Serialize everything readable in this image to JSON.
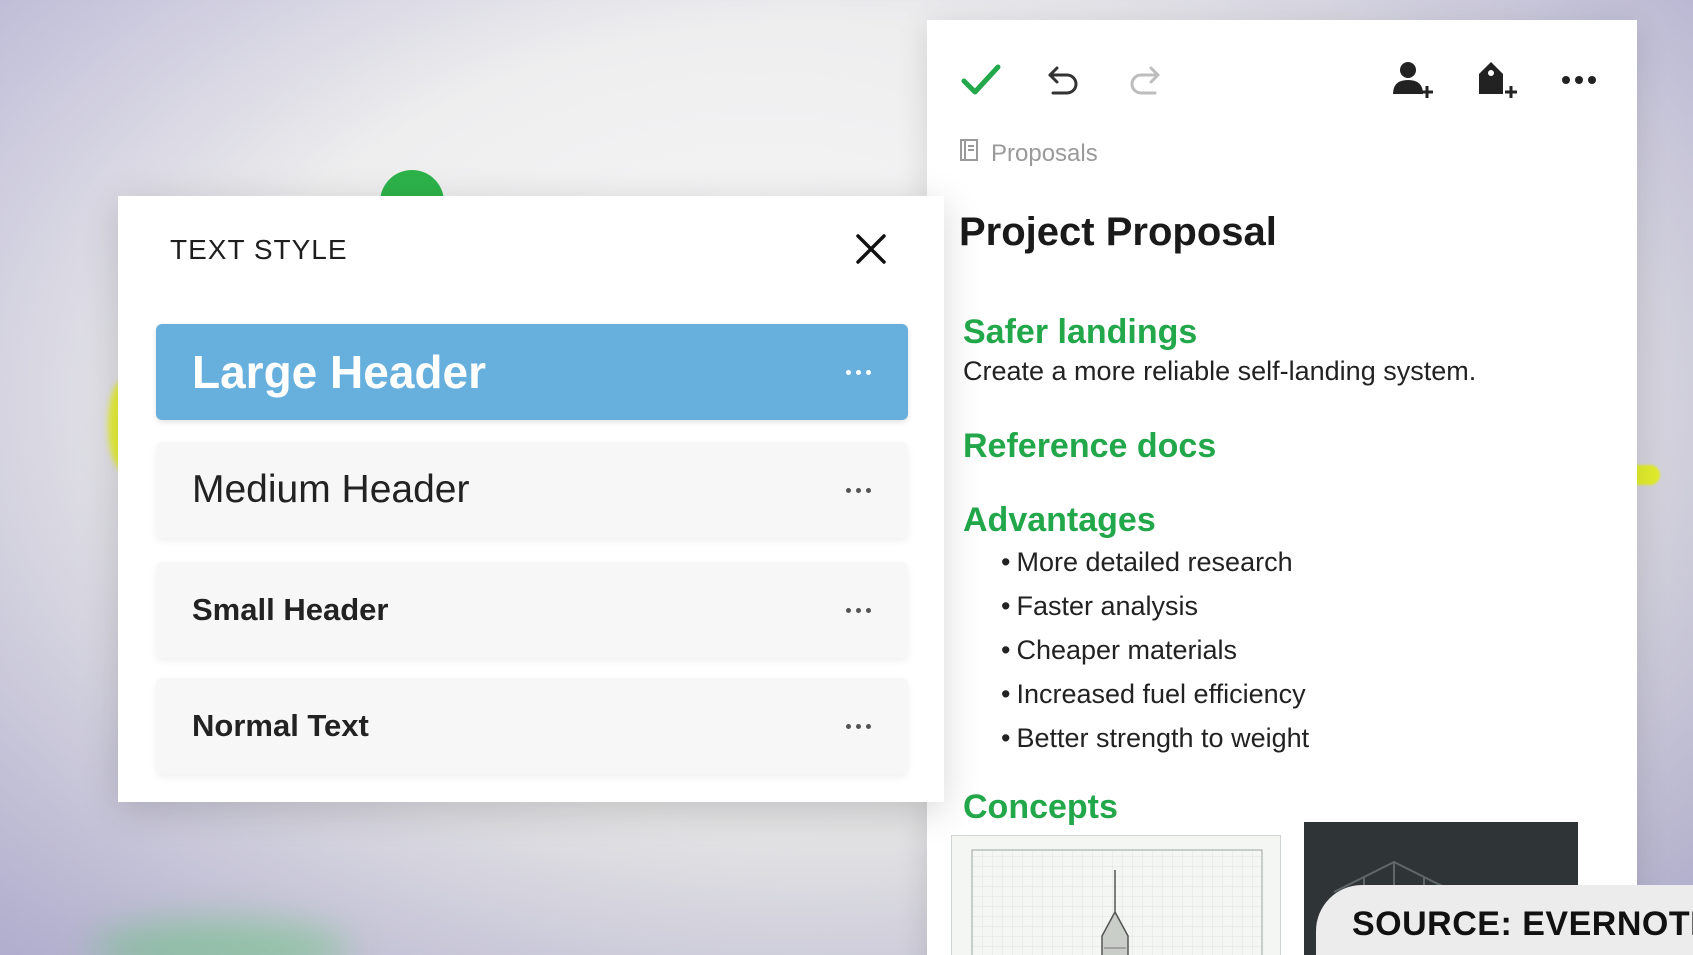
{
  "note": {
    "toolbar": {
      "done_icon": "check-icon",
      "undo_icon": "undo-icon",
      "redo_icon": "redo-icon",
      "share_icon": "add-person-icon",
      "tag_icon": "add-tag-icon",
      "more_icon": "more-horizontal-icon"
    },
    "notebook": "Proposals",
    "title": "Project Proposal",
    "sections": [
      {
        "heading": "Safer landings",
        "text": "Create a more reliable self-landing system."
      },
      {
        "heading": "Reference docs"
      },
      {
        "heading": "Advantages"
      },
      {
        "heading": "Concepts"
      }
    ],
    "advantages": [
      "More detailed research",
      "Faster analysis",
      "Cheaper materials",
      "Increased fuel efficiency",
      "Better strength to weight"
    ],
    "colors": {
      "heading": "#22a84a",
      "check": "#22a84a"
    }
  },
  "dialog": {
    "title": "TEXT STYLE",
    "close_icon": "close-icon",
    "options": [
      {
        "label": "Large Header",
        "selected": true
      },
      {
        "label": "Medium Header",
        "selected": false
      },
      {
        "label": "Small Header",
        "selected": false
      },
      {
        "label": "Normal Text",
        "selected": false
      }
    ],
    "colors": {
      "selected": "#67b0dd"
    }
  },
  "source_badge": "SOURCE: EVERNOTE"
}
